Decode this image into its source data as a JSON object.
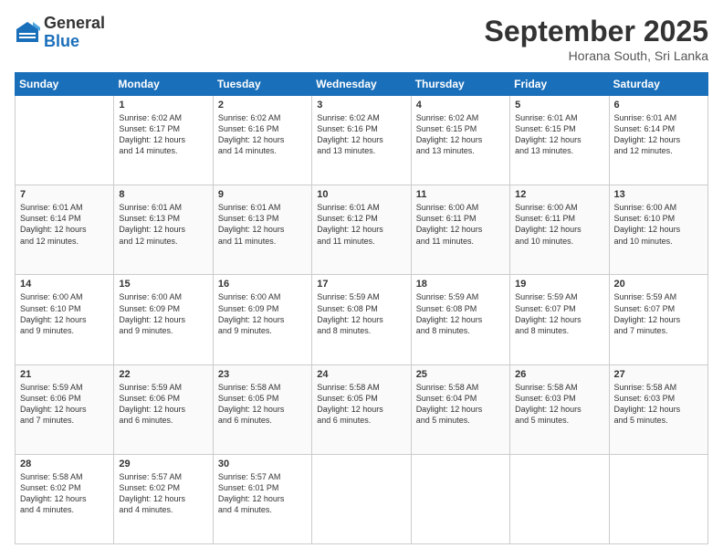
{
  "header": {
    "logo": {
      "general": "General",
      "blue": "Blue"
    },
    "title": "September 2025",
    "location": "Horana South, Sri Lanka"
  },
  "weekdays": [
    "Sunday",
    "Monday",
    "Tuesday",
    "Wednesday",
    "Thursday",
    "Friday",
    "Saturday"
  ],
  "weeks": [
    [
      {
        "day": "",
        "info": ""
      },
      {
        "day": "1",
        "info": "Sunrise: 6:02 AM\nSunset: 6:17 PM\nDaylight: 12 hours\nand 14 minutes."
      },
      {
        "day": "2",
        "info": "Sunrise: 6:02 AM\nSunset: 6:16 PM\nDaylight: 12 hours\nand 14 minutes."
      },
      {
        "day": "3",
        "info": "Sunrise: 6:02 AM\nSunset: 6:16 PM\nDaylight: 12 hours\nand 13 minutes."
      },
      {
        "day": "4",
        "info": "Sunrise: 6:02 AM\nSunset: 6:15 PM\nDaylight: 12 hours\nand 13 minutes."
      },
      {
        "day": "5",
        "info": "Sunrise: 6:01 AM\nSunset: 6:15 PM\nDaylight: 12 hours\nand 13 minutes."
      },
      {
        "day": "6",
        "info": "Sunrise: 6:01 AM\nSunset: 6:14 PM\nDaylight: 12 hours\nand 12 minutes."
      }
    ],
    [
      {
        "day": "7",
        "info": "Sunrise: 6:01 AM\nSunset: 6:14 PM\nDaylight: 12 hours\nand 12 minutes."
      },
      {
        "day": "8",
        "info": "Sunrise: 6:01 AM\nSunset: 6:13 PM\nDaylight: 12 hours\nand 12 minutes."
      },
      {
        "day": "9",
        "info": "Sunrise: 6:01 AM\nSunset: 6:13 PM\nDaylight: 12 hours\nand 11 minutes."
      },
      {
        "day": "10",
        "info": "Sunrise: 6:01 AM\nSunset: 6:12 PM\nDaylight: 12 hours\nand 11 minutes."
      },
      {
        "day": "11",
        "info": "Sunrise: 6:00 AM\nSunset: 6:11 PM\nDaylight: 12 hours\nand 11 minutes."
      },
      {
        "day": "12",
        "info": "Sunrise: 6:00 AM\nSunset: 6:11 PM\nDaylight: 12 hours\nand 10 minutes."
      },
      {
        "day": "13",
        "info": "Sunrise: 6:00 AM\nSunset: 6:10 PM\nDaylight: 12 hours\nand 10 minutes."
      }
    ],
    [
      {
        "day": "14",
        "info": "Sunrise: 6:00 AM\nSunset: 6:10 PM\nDaylight: 12 hours\nand 9 minutes."
      },
      {
        "day": "15",
        "info": "Sunrise: 6:00 AM\nSunset: 6:09 PM\nDaylight: 12 hours\nand 9 minutes."
      },
      {
        "day": "16",
        "info": "Sunrise: 6:00 AM\nSunset: 6:09 PM\nDaylight: 12 hours\nand 9 minutes."
      },
      {
        "day": "17",
        "info": "Sunrise: 5:59 AM\nSunset: 6:08 PM\nDaylight: 12 hours\nand 8 minutes."
      },
      {
        "day": "18",
        "info": "Sunrise: 5:59 AM\nSunset: 6:08 PM\nDaylight: 12 hours\nand 8 minutes."
      },
      {
        "day": "19",
        "info": "Sunrise: 5:59 AM\nSunset: 6:07 PM\nDaylight: 12 hours\nand 8 minutes."
      },
      {
        "day": "20",
        "info": "Sunrise: 5:59 AM\nSunset: 6:07 PM\nDaylight: 12 hours\nand 7 minutes."
      }
    ],
    [
      {
        "day": "21",
        "info": "Sunrise: 5:59 AM\nSunset: 6:06 PM\nDaylight: 12 hours\nand 7 minutes."
      },
      {
        "day": "22",
        "info": "Sunrise: 5:59 AM\nSunset: 6:06 PM\nDaylight: 12 hours\nand 6 minutes."
      },
      {
        "day": "23",
        "info": "Sunrise: 5:58 AM\nSunset: 6:05 PM\nDaylight: 12 hours\nand 6 minutes."
      },
      {
        "day": "24",
        "info": "Sunrise: 5:58 AM\nSunset: 6:05 PM\nDaylight: 12 hours\nand 6 minutes."
      },
      {
        "day": "25",
        "info": "Sunrise: 5:58 AM\nSunset: 6:04 PM\nDaylight: 12 hours\nand 5 minutes."
      },
      {
        "day": "26",
        "info": "Sunrise: 5:58 AM\nSunset: 6:03 PM\nDaylight: 12 hours\nand 5 minutes."
      },
      {
        "day": "27",
        "info": "Sunrise: 5:58 AM\nSunset: 6:03 PM\nDaylight: 12 hours\nand 5 minutes."
      }
    ],
    [
      {
        "day": "28",
        "info": "Sunrise: 5:58 AM\nSunset: 6:02 PM\nDaylight: 12 hours\nand 4 minutes."
      },
      {
        "day": "29",
        "info": "Sunrise: 5:57 AM\nSunset: 6:02 PM\nDaylight: 12 hours\nand 4 minutes."
      },
      {
        "day": "30",
        "info": "Sunrise: 5:57 AM\nSunset: 6:01 PM\nDaylight: 12 hours\nand 4 minutes."
      },
      {
        "day": "",
        "info": ""
      },
      {
        "day": "",
        "info": ""
      },
      {
        "day": "",
        "info": ""
      },
      {
        "day": "",
        "info": ""
      }
    ]
  ]
}
